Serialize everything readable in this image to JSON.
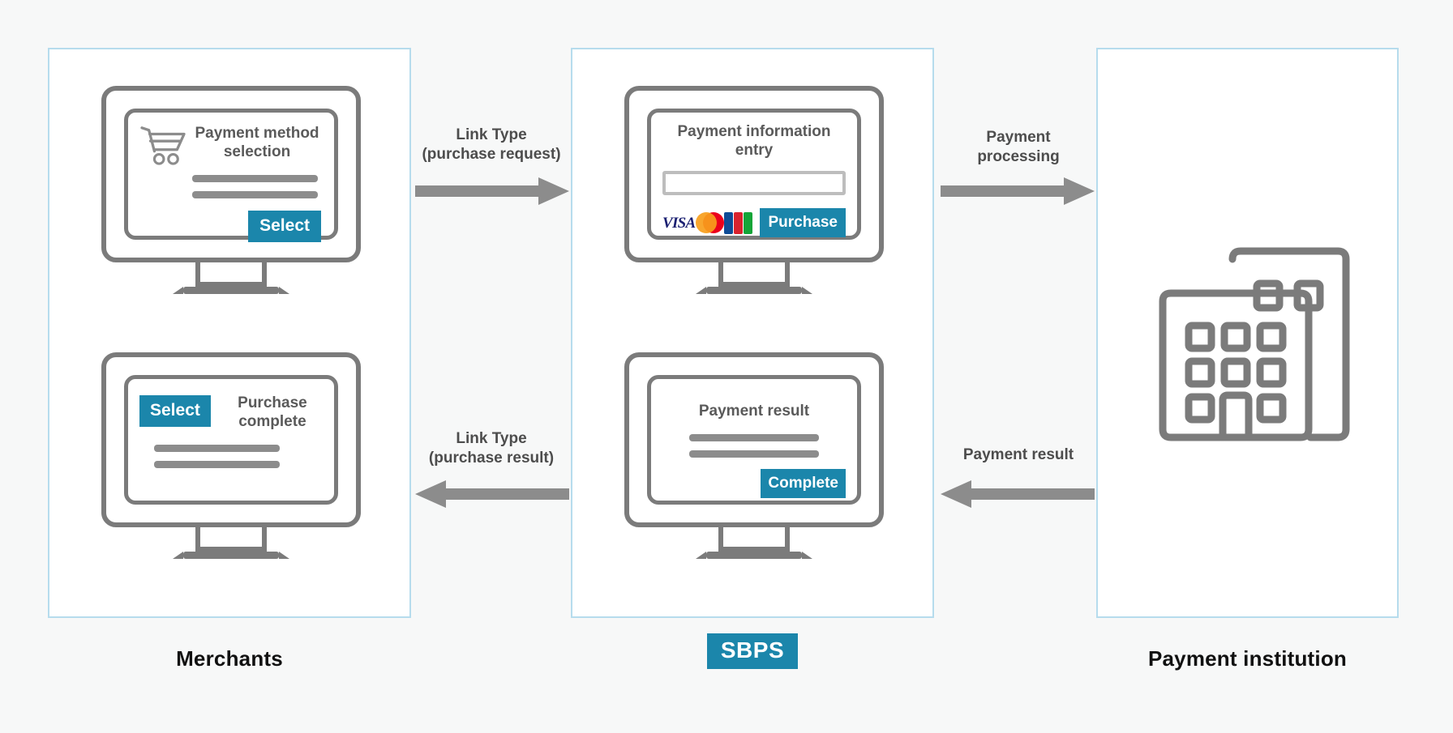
{
  "colors": {
    "accent": "#1b86ab",
    "panel_border": "#b6dced",
    "device_outline": "#7b7b7b",
    "text_grey": "#5a5a5a",
    "arrow_grey": "#8c8c8c",
    "background": "#f7f8f8",
    "visa_blue": "#1a1f71",
    "mastercard_red": "#eb001b",
    "mastercard_yellow": "#f79e1b",
    "jcb_blue": "#0e4c96",
    "jcb_red": "#d9232e",
    "jcb_green": "#13a538"
  },
  "columns": {
    "merchants": {
      "label": "Merchants"
    },
    "sbps": {
      "label": "SBPS"
    },
    "institution": {
      "label": "Payment institution"
    }
  },
  "screens": {
    "payment_method_selection": {
      "title": "Payment method selection",
      "button_label": "Select",
      "icon": "shopping-cart-icon"
    },
    "purchase_complete": {
      "title": "Purchase complete",
      "button_label": "Select"
    },
    "payment_information_entry": {
      "title": "Payment information entry",
      "input_value": "",
      "input_placeholder": "",
      "button_label": "Purchase",
      "card_brands": [
        "VISA",
        "Mastercard",
        "JCB"
      ],
      "visa_text": "VISA"
    },
    "payment_result": {
      "title": "Payment result",
      "button_label": "Complete"
    }
  },
  "arrows": {
    "purchase_request": {
      "label": "Link Type\n(purchase request)",
      "direction": "right"
    },
    "purchase_result": {
      "label": "Link Type\n(purchase result)",
      "direction": "left"
    },
    "payment_processing": {
      "label": "Payment\nprocessing",
      "direction": "right"
    },
    "payment_result": {
      "label": "Payment result",
      "direction": "left"
    }
  }
}
